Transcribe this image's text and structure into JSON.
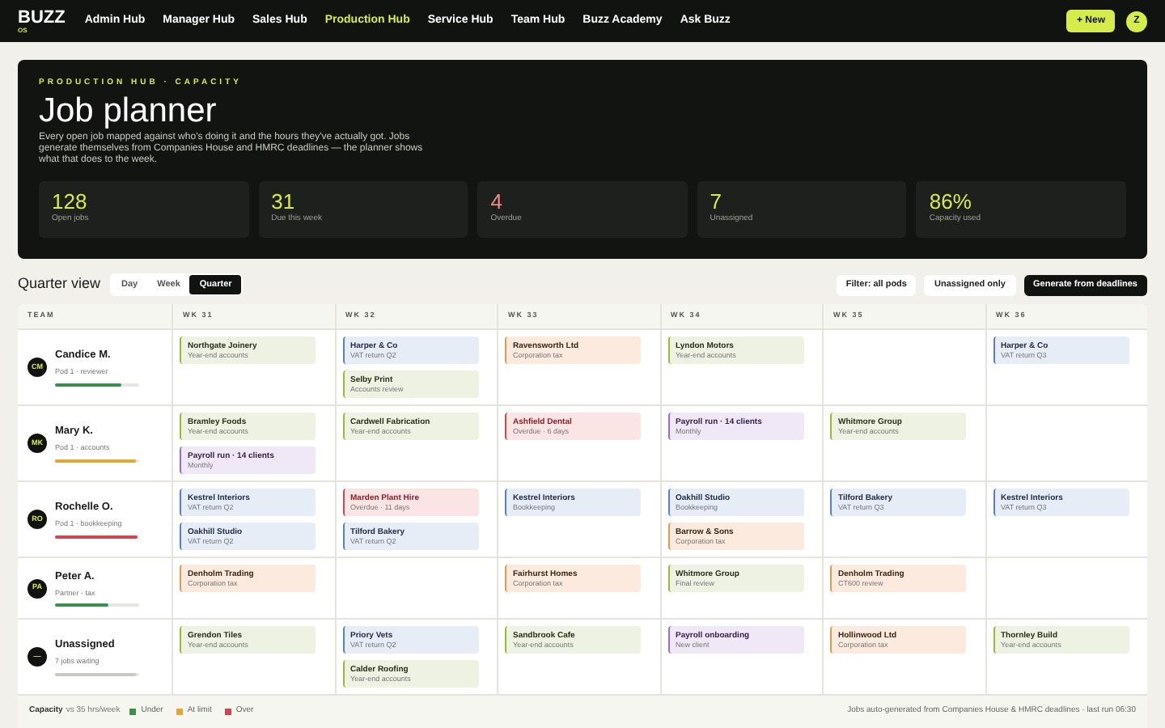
{
  "nav": {
    "logo": "BUZZ",
    "logo_sub": "OS",
    "items": [
      {
        "label": "Admin Hub",
        "selected": false
      },
      {
        "label": "Manager Hub",
        "selected": false
      },
      {
        "label": "Sales Hub",
        "selected": false
      },
      {
        "label": "Production Hub",
        "selected": true
      },
      {
        "label": "Service Hub",
        "selected": false
      },
      {
        "label": "Team Hub",
        "selected": false
      },
      {
        "label": "Buzz Academy",
        "selected": false
      },
      {
        "label": "Ask Buzz",
        "selected": false
      }
    ],
    "new_button": "+ New",
    "avatar": "Z"
  },
  "hero": {
    "eyebrow": "PRODUCTION HUB · CAPACITY",
    "title": "Job planner",
    "description": "Every open job mapped against who's doing it and the hours they've actually got. Jobs generate themselves from Companies House and HMRC deadlines — the planner shows what that does to the week.",
    "stats": [
      {
        "value": "128",
        "label": "Open jobs",
        "kind": "normal"
      },
      {
        "value": "31",
        "label": "Due this week",
        "kind": "normal"
      },
      {
        "value": "4",
        "label": "Overdue",
        "kind": "alert"
      },
      {
        "value": "7",
        "label": "Unassigned",
        "kind": "normal"
      },
      {
        "value": "86%",
        "label": "Capacity used",
        "kind": "normal"
      }
    ]
  },
  "toolbar": {
    "title": "Quarter view",
    "views": [
      {
        "label": "Day",
        "selected": false
      },
      {
        "label": "Week",
        "selected": false
      },
      {
        "label": "Quarter",
        "selected": true
      }
    ],
    "buttons": [
      {
        "label": "Filter: all pods",
        "kind": "secondary"
      },
      {
        "label": "Unassigned only",
        "kind": "secondary"
      },
      {
        "label": "Generate from deadlines",
        "kind": "primary"
      }
    ]
  },
  "table": {
    "columns": [
      "TEAM",
      "WK 31",
      "WK 32",
      "WK 33",
      "WK 34",
      "WK 35",
      "WK 36"
    ],
    "rows": [
      {
        "initials": "CM",
        "name": "Candice M.",
        "role": "Pod 1 · reviewer",
        "color": "#3d8f4e",
        "level": 0.78,
        "weeks": [
          {
            "kind": "jobs",
            "jobs": [
              {
                "client": "Northgate Joinery",
                "task": "Year-end accounts",
                "kind": "accounts"
              }
            ]
          },
          {
            "kind": "jobs",
            "jobs": [
              {
                "client": "Harper & Co",
                "task": "VAT return Q2",
                "kind": "vat"
              },
              {
                "client": "Selby Print",
                "task": "Accounts review",
                "kind": "accounts"
              }
            ]
          },
          {
            "kind": "jobs",
            "jobs": [
              {
                "client": "Ravensworth Ltd",
                "task": "Corporation tax",
                "kind": "tax"
              }
            ]
          },
          {
            "kind": "jobs",
            "jobs": [
              {
                "client": "Lyndon Motors",
                "task": "Year-end accounts",
                "kind": "accounts"
              }
            ]
          },
          {
            "kind": "empty"
          },
          {
            "kind": "jobs",
            "jobs": [
              {
                "client": "Harper & Co",
                "task": "VAT return Q3",
                "kind": "vat"
              }
            ]
          }
        ]
      },
      {
        "initials": "MK",
        "name": "Mary K.",
        "role": "Pod 1 · accounts",
        "color": "#e3a63a",
        "level": 0.96,
        "weeks": [
          {
            "kind": "jobs",
            "jobs": [
              {
                "client": "Bramley Foods",
                "task": "Year-end accounts",
                "kind": "accounts"
              },
              {
                "client": "Payroll run · 14 clients",
                "task": "Monthly",
                "kind": "payroll"
              }
            ]
          },
          {
            "kind": "jobs",
            "jobs": [
              {
                "client": "Cardwell Fabrication",
                "task": "Year-end accounts",
                "kind": "accounts"
              }
            ]
          },
          {
            "kind": "jobs",
            "jobs": [
              {
                "client": "Ashfield Dental",
                "task": "Overdue · 6 days",
                "kind": "overdue"
              }
            ]
          },
          {
            "kind": "jobs",
            "jobs": [
              {
                "client": "Payroll run · 14 clients",
                "task": "Monthly",
                "kind": "payroll"
              }
            ]
          },
          {
            "kind": "jobs",
            "jobs": [
              {
                "client": "Whitmore Group",
                "task": "Year-end accounts",
                "kind": "accounts"
              }
            ]
          },
          {
            "kind": "empty"
          }
        ]
      },
      {
        "initials": "RO",
        "name": "Rochelle O.",
        "role": "Pod 1 · bookkeeping",
        "color": "#d0454f",
        "level": 0.98,
        "weeks": [
          {
            "kind": "jobs",
            "jobs": [
              {
                "client": "Kestrel Interiors",
                "task": "VAT return Q2",
                "kind": "vat"
              },
              {
                "client": "Oakhill Studio",
                "task": "VAT return Q2",
                "kind": "vat"
              }
            ]
          },
          {
            "kind": "jobs",
            "jobs": [
              {
                "client": "Marden Plant Hire",
                "task": "Overdue · 11 days",
                "kind": "overdue"
              },
              {
                "client": "Tilford Bakery",
                "task": "VAT return Q2",
                "kind": "vat"
              }
            ]
          },
          {
            "kind": "jobs",
            "jobs": [
              {
                "client": "Kestrel Interiors",
                "task": "Bookkeeping",
                "kind": "vat"
              }
            ]
          },
          {
            "kind": "jobs",
            "jobs": [
              {
                "client": "Oakhill Studio",
                "task": "Bookkeeping",
                "kind": "vat"
              },
              {
                "client": "Barrow & Sons",
                "task": "Corporation tax",
                "kind": "tax"
              }
            ]
          },
          {
            "kind": "jobs",
            "jobs": [
              {
                "client": "Tilford Bakery",
                "task": "VAT return Q3",
                "kind": "vat"
              }
            ]
          },
          {
            "kind": "jobs",
            "jobs": [
              {
                "client": "Kestrel Interiors",
                "task": "VAT return Q3",
                "kind": "vat"
              }
            ]
          }
        ]
      },
      {
        "initials": "PA",
        "name": "Peter A.",
        "role": "Partner · tax",
        "color": "#3d8f4e",
        "level": 0.64,
        "weeks": [
          {
            "kind": "jobs",
            "jobs": [
              {
                "client": "Denholm Trading",
                "task": "Corporation tax",
                "kind": "tax"
              }
            ]
          },
          {
            "kind": "empty"
          },
          {
            "kind": "jobs",
            "jobs": [
              {
                "client": "Fairhurst Homes",
                "task": "Corporation tax",
                "kind": "tax"
              }
            ]
          },
          {
            "kind": "jobs",
            "jobs": [
              {
                "client": "Whitmore Group",
                "task": "Final review",
                "kind": "accounts"
              }
            ]
          },
          {
            "kind": "jobs",
            "jobs": [
              {
                "client": "Denholm Trading",
                "task": "CT600 review",
                "kind": "tax"
              }
            ]
          },
          {
            "kind": "empty"
          }
        ]
      },
      {
        "initials": "—",
        "name": "Unassigned",
        "role": "7 jobs waiting",
        "color": "#c9c9c4",
        "level": 0.96,
        "weeks": [
          {
            "kind": "jobs",
            "jobs": [
              {
                "client": "Grendon Tiles",
                "task": "Year-end accounts",
                "kind": "accounts"
              }
            ]
          },
          {
            "kind": "jobs",
            "jobs": [
              {
                "client": "Priory Vets",
                "task": "VAT return Q2",
                "kind": "vat"
              },
              {
                "client": "Calder Roofing",
                "task": "Year-end accounts",
                "kind": "accounts"
              }
            ]
          },
          {
            "kind": "jobs",
            "jobs": [
              {
                "client": "Sandbrook Cafe",
                "task": "Year-end accounts",
                "kind": "accounts"
              }
            ]
          },
          {
            "kind": "jobs",
            "jobs": [
              {
                "client": "Payroll onboarding",
                "task": "New client",
                "kind": "payroll"
              }
            ]
          },
          {
            "kind": "jobs",
            "jobs": [
              {
                "client": "Hollinwood Ltd",
                "task": "Corporation tax",
                "kind": "tax"
              }
            ]
          },
          {
            "kind": "jobs",
            "jobs": [
              {
                "client": "Thornley Build",
                "task": "Year-end accounts",
                "kind": "accounts"
              }
            ]
          }
        ]
      }
    ]
  },
  "footer": {
    "legend_title": "Capacity",
    "legend_note": "vs 35 hrs/week",
    "legend": [
      {
        "label": "Under",
        "color": "#3d8f4e"
      },
      {
        "label": "At limit",
        "color": "#e3a63a"
      },
      {
        "label": "Over",
        "color": "#d0454f"
      }
    ],
    "note": "Jobs auto-generated from Companies House & HMRC deadlines · last run 06:30"
  }
}
